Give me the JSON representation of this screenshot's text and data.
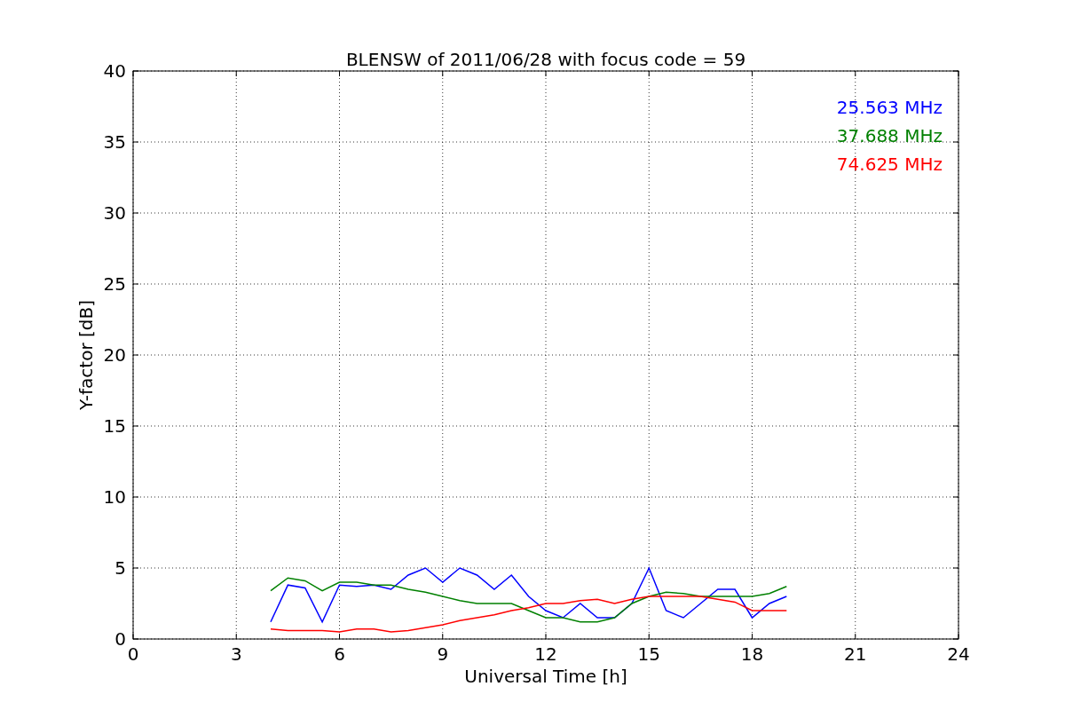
{
  "chart_data": {
    "type": "line",
    "title": "BLENSW of 2011/06/28 with focus code = 59",
    "xlabel": "Universal Time [h]",
    "ylabel": "Y-factor [dB]",
    "x": [
      4,
      4.5,
      5,
      5.5,
      6,
      6.5,
      7,
      7.5,
      8,
      8.5,
      9,
      9.5,
      10,
      10.5,
      11,
      11.5,
      12,
      12.5,
      13,
      13.5,
      14,
      14.5,
      15,
      15.5,
      16,
      16.5,
      17,
      17.5,
      18,
      18.5,
      19
    ],
    "series": [
      {
        "name": "25.563 MHz",
        "color": "#0000ff",
        "values": [
          1.2,
          3.8,
          3.6,
          1.2,
          3.8,
          3.7,
          3.8,
          3.5,
          4.5,
          5,
          4,
          5,
          4.5,
          3.5,
          4.5,
          3,
          2,
          1.5,
          2.5,
          1.5,
          1.5,
          2.5,
          5,
          2,
          1.5,
          2.5,
          3.5,
          3.5,
          1.5,
          2.5,
          3
        ]
      },
      {
        "name": "37.688 MHz",
        "color": "#008000",
        "values": [
          3.4,
          4.3,
          4.1,
          3.4,
          4,
          4,
          3.8,
          3.8,
          3.5,
          3.3,
          3,
          2.7,
          2.5,
          2.5,
          2.5,
          2,
          1.5,
          1.5,
          1.2,
          1.2,
          1.5,
          2.5,
          3,
          3.3,
          3.2,
          3,
          3,
          3,
          3,
          3.2,
          3.7
        ]
      },
      {
        "name": "74.625 MHz",
        "color": "#ff0000",
        "values": [
          0.7,
          0.6,
          0.6,
          0.6,
          0.5,
          0.7,
          0.7,
          0.5,
          0.6,
          0.8,
          1,
          1.3,
          1.5,
          1.7,
          2,
          2.2,
          2.5,
          2.5,
          2.7,
          2.8,
          2.5,
          2.8,
          3,
          3,
          3,
          3,
          2.8,
          2.6,
          2,
          2,
          2
        ]
      }
    ],
    "xlim": [
      0,
      24
    ],
    "ylim": [
      0,
      40
    ],
    "xticks": [
      0,
      3,
      6,
      9,
      12,
      15,
      18,
      21,
      24
    ],
    "yticks": [
      0,
      5,
      10,
      15,
      20,
      25,
      30,
      35,
      40
    ],
    "grid": true
  }
}
